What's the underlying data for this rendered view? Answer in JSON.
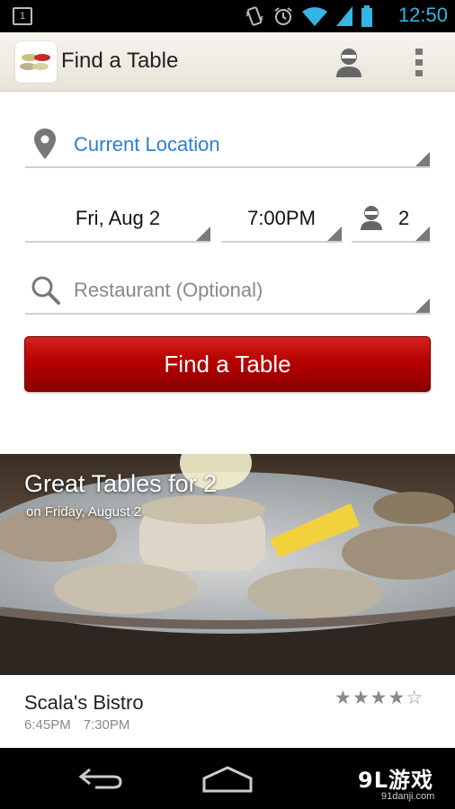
{
  "status_bar": {
    "notification_badge": "1",
    "time": "12:50",
    "icons": [
      "vibrate-icon",
      "alarm-icon",
      "wifi-icon",
      "signal-icon",
      "battery-icon"
    ],
    "accent_color": "#33b5e5"
  },
  "action_bar": {
    "title": "Find a Table",
    "icons": [
      "app-logo-icon",
      "profile-icon",
      "overflow-menu-icon"
    ]
  },
  "search_form": {
    "location": "Current Location",
    "date": "Fri, Aug 2",
    "time": "7:00PM",
    "party_size": "2",
    "restaurant_placeholder": "Restaurant (Optional)",
    "submit_label": "Find a Table",
    "button_color": "#b70000",
    "link_color": "#2d7fd1"
  },
  "promo": {
    "title": "Great Tables for 2",
    "subtitle": "on Friday, August 2"
  },
  "listings": [
    {
      "name": "Scala's Bistro",
      "times": [
        "6:45PM",
        "7:30PM"
      ],
      "rating": 4,
      "max_rating": 5
    }
  ],
  "watermark": {
    "brand": "9L游戏",
    "url": "91danji.com"
  }
}
